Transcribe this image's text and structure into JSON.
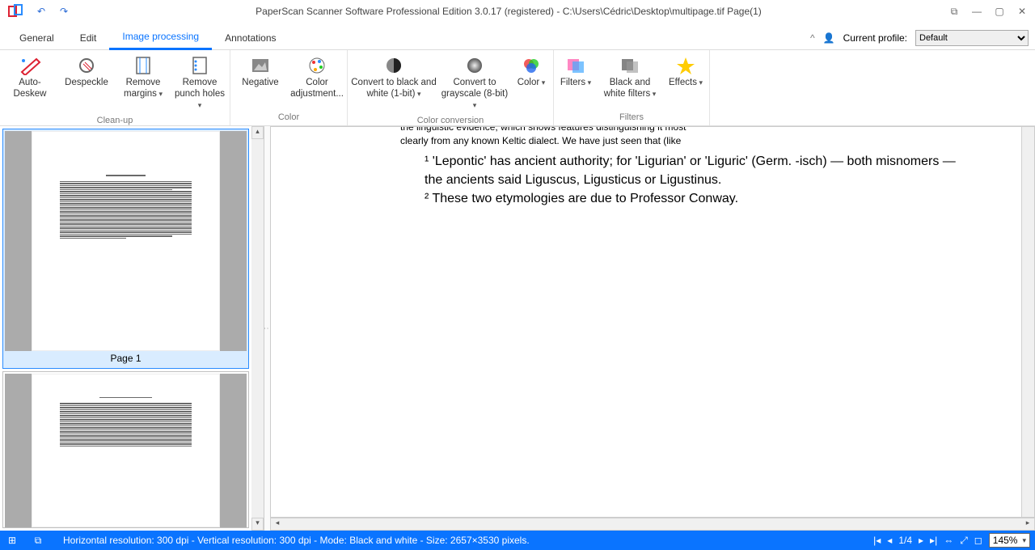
{
  "title": "PaperScan Scanner Software Professional Edition 3.0.17 (registered) - C:\\Users\\Cédric\\Desktop\\multipage.tif Page(1)",
  "tabs": {
    "general": "General",
    "edit": "Edit",
    "image_processing": "Image processing",
    "annotations": "Annotations"
  },
  "profile": {
    "label": "Current profile:",
    "value": "Default"
  },
  "ribbon": {
    "cleanup": {
      "label": "Clean-up",
      "auto_deskew": "Auto-Deskew",
      "despeckle": "Despeckle",
      "remove_margins": "Remove margins",
      "remove_punch": "Remove punch holes"
    },
    "color": {
      "label": "Color",
      "negative": "Negative",
      "adjustment": "Color adjustment..."
    },
    "conversion": {
      "label": "Color conversion",
      "bw": "Convert to black and white (1-bit)",
      "gray": "Convert to grayscale (8-bit)",
      "color_btn": "Color"
    },
    "filters": {
      "label": "Filters",
      "filters_btn": "Filters",
      "bw_filters": "Black and white filters",
      "effects": "Effects"
    }
  },
  "thumbs": {
    "page1": "Page 1"
  },
  "preview": {
    "line1_a": "the linguistic evidence, which shows features distinguishing it most",
    "line1_b": "clearly from any known Keltic dialect.  We have just seen that (like",
    "note1": "¹ 'Lepontic' has ancient authority; for 'Ligurian' or 'Liguric' (Germ. -isch) — both misnomers — the ancients said Liguscus, Ligusticus or Ligustinus.",
    "note2": "² These two etymologies are due to Professor Conway."
  },
  "status": {
    "text": "Horizontal resolution:  300 dpi - Vertical resolution:  300 dpi - Mode: Black and white - Size: 2657×3530 pixels.",
    "page": "1/4",
    "zoom": "145%"
  }
}
